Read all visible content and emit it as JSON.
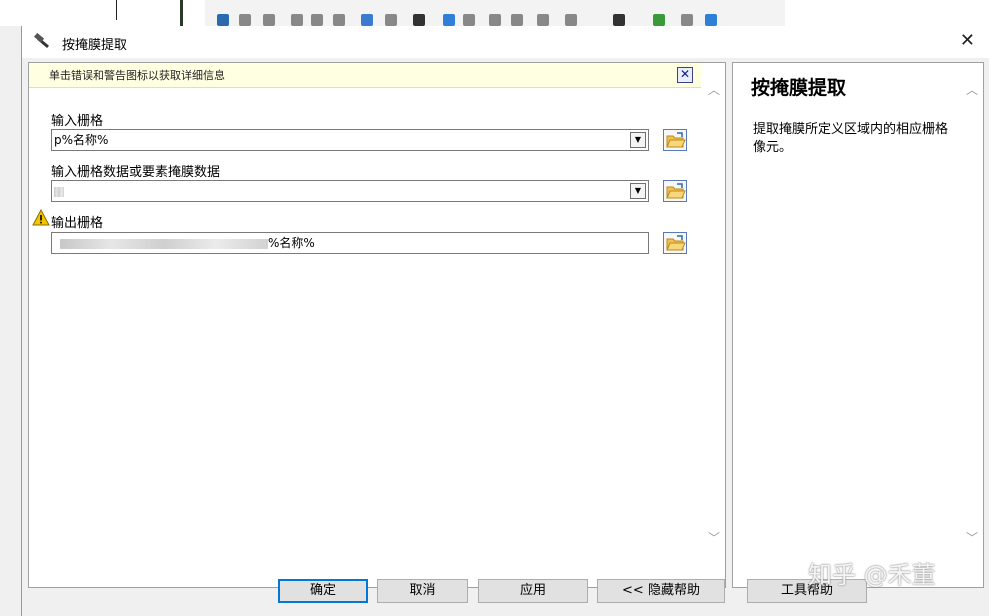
{
  "dialog": {
    "title": "按掩膜提取",
    "close_glyph": "✕"
  },
  "info_bar": {
    "text": "单击错误和警告图标以获取详细信息",
    "close_glyph": "✕"
  },
  "form": {
    "input_raster": {
      "label": "输入栅格",
      "value": "p%名称%"
    },
    "mask_data": {
      "label": "输入栅格数据或要素掩膜数据",
      "value": ""
    },
    "output_raster": {
      "label": "输出栅格",
      "value_visible_suffix": "%名称%"
    }
  },
  "help": {
    "title": "按掩膜提取",
    "body": "提取掩膜所定义区域内的相应栅格像元。"
  },
  "buttons": {
    "ok": "确定",
    "cancel": "取消",
    "apply": "应用",
    "hide_help": "<< 隐藏帮助",
    "tool_help": "工具帮助"
  },
  "watermark": "知乎 @禾董",
  "icons": {
    "title": "hammer-icon",
    "warning": "warning-icon",
    "browse": "folder-open-icon",
    "dropdown": "dropdown-arrow-icon"
  },
  "colors": {
    "info_bar_bg": "#ffffe1",
    "primary_border": "#0078d7",
    "warning": "#f5c400"
  }
}
